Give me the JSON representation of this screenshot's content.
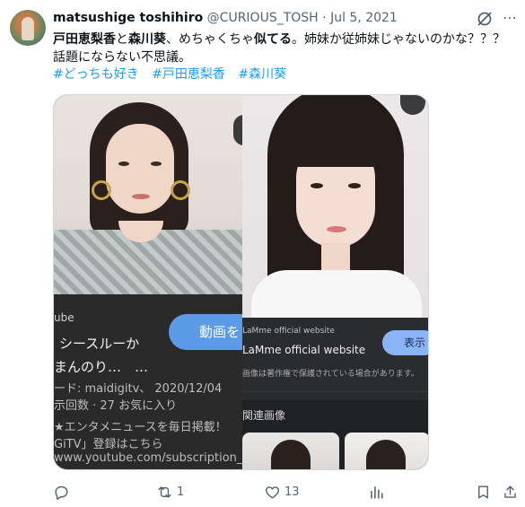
{
  "author": {
    "name": "matsushige toshihiro",
    "handle": "@CURIOUS_TOSH",
    "separator": "·",
    "date": "Jul 5, 2021"
  },
  "tweet": {
    "part1": "戸田恵梨香",
    "part2": "と",
    "part3": "森川葵",
    "part4": "、めちゃくちゃ",
    "part5": "似てる",
    "part6": "。姉妹か従姉妹じゃないのかな？？？話題にならない不思議。",
    "hashtags": [
      "#どっちも好き",
      "#戸田恵梨香",
      "#森川葵"
    ]
  },
  "left_panel": {
    "source": "ube",
    "title_line1": "シースルーか",
    "title_line2": "まんのり…　…",
    "meta_line1": "ード: maidigitv、 2020/12/04",
    "meta_line2": "示回数 · 27 お気に入り",
    "desc_line1": "★エンタメニュースを毎日掲載！",
    "desc_line2": "GiTV」登録はこちら",
    "desc_line3": "www.youtube.com/subscription_c",
    "button_label": "動画を"
  },
  "right_panel": {
    "source_small": "LaMme official website",
    "source_title": "LaMme official website",
    "show_label": "表示",
    "copyright": "画像は著作権で保護されている場合があります。",
    "related_label": "関連画像"
  },
  "actions": {
    "reply_count": "",
    "retweet_count": "1",
    "like_count": "13",
    "views_count": ""
  }
}
